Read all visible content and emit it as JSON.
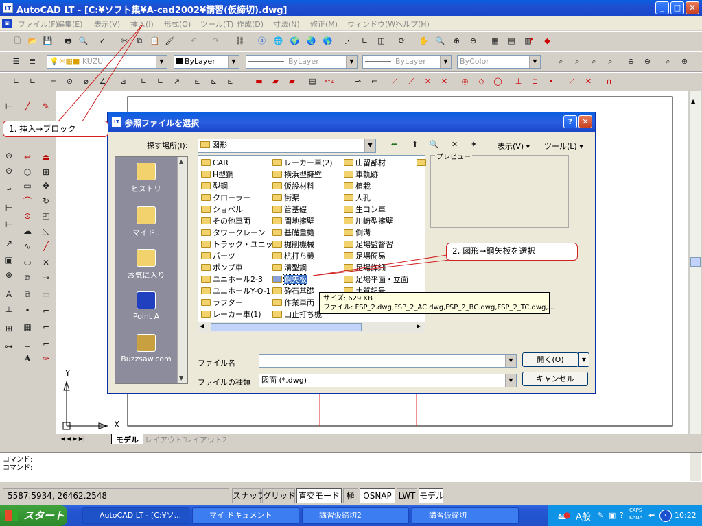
{
  "window": {
    "title": "AutoCAD LT - [C:¥ソフト集¥A-cad2002¥講習(仮締切).dwg]",
    "app_icon": "LT"
  },
  "menu": [
    "ファイル(F)",
    "編集(E)",
    "表示(V)",
    "挿入(I)",
    "形式(O)",
    "ツール(T)",
    "作成(D)",
    "寸法(N)",
    "修正(M)",
    "ウィンドウ(W)",
    "ヘルプ(H)"
  ],
  "layer_combo": "KUZU",
  "prop_combos": [
    "ByLayer",
    "ByLayer",
    "ByLayer",
    "ByColor"
  ],
  "ucs": {
    "y": "Y",
    "x": "X"
  },
  "layout_tabs": [
    "モデル",
    "レイアウト1",
    "レイアウト2"
  ],
  "command_lines": [
    "コマンド:",
    "コマンド:"
  ],
  "coords": "5587.5934,  26462.2548",
  "status_buttons": [
    "スナップ",
    "グリッド",
    "直交モード",
    "極",
    "OSNAP",
    "LWT",
    "モデル"
  ],
  "dialog": {
    "title": "参照ファイルを選択",
    "lookin_label": "探す場所(I):",
    "lookin_value": "図形",
    "view_label": "表示(V)",
    "tools_label": "ツール(L)",
    "preview_label": "プレビュー",
    "places": [
      "ヒストリ",
      "マイド..",
      "お気に入り",
      "Point A",
      "Buzzsaw.com"
    ],
    "columns": [
      [
        "CAR",
        "H型鋼",
        "型鋼",
        "クローラー",
        "ショベル",
        "その他車両",
        "タワークレーン",
        "トラック・ユニック",
        "パーツ",
        "ポンプ車",
        "ユニホール2-3",
        "ユニホールY-O-1",
        "ラフター",
        "レーカー車(1)"
      ],
      [
        "レーカー車(2)",
        "横浜型擁壁",
        "仮設材料",
        "街渠",
        "管基礎",
        "間地擁壁",
        "基礎重機",
        "掘削機械",
        "杭打ち機",
        "溝型鋼",
        "鋼矢板",
        "砕石基礎",
        "作業車両",
        "山止打ち機"
      ],
      [
        "山留部材",
        "車軌跡",
        "植栽",
        "人孔",
        "生コン車",
        "川崎型擁壁",
        "側溝",
        "足場監督習",
        "足場簡易",
        "足場詳細",
        "足場平面・立面",
        "土質記号"
      ]
    ],
    "selected_item": "鋼矢板",
    "tooltip_size": "サイズ: 629 KB",
    "tooltip_files": "ファイル: FSP_2.dwg,FSP_2_AC.dwg,FSP_2_BC.dwg,FSP_2_TC.dwg,...",
    "filename_label": "ファイル名",
    "filename_value": "",
    "filetype_label": "ファイルの種類",
    "filetype_value": "図面 (*.dwg)",
    "open_button": "開く(O)",
    "cancel_button": "キャンセル"
  },
  "callouts": [
    "1. 挿入→ブロック",
    "2. 図形→鋼矢板を選択"
  ],
  "taskbar": {
    "start": "スタート",
    "tasks": [
      "AutoCAD LT - [C:¥ソ...",
      "マイ ドキュメント",
      "講習仮締切2",
      "講習仮締切"
    ],
    "tray_text": "A般",
    "tray_caps": "CAPS",
    "tray_kana": "KANA",
    "clock": "10:22"
  },
  "colors": {
    "accent": "#0a5fe0",
    "callout_border": "#d02020",
    "selection": "#316ac5"
  }
}
